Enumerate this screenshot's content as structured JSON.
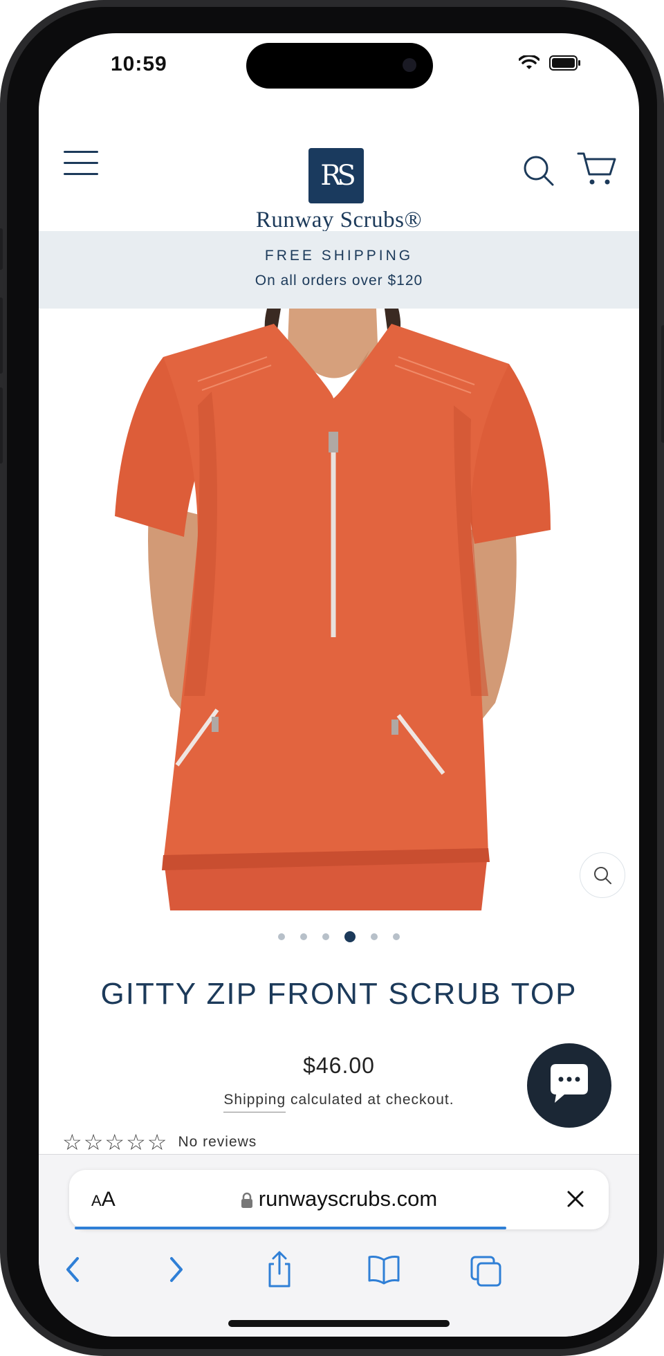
{
  "status_bar": {
    "time": "10:59"
  },
  "header": {
    "logo_monogram": "RS",
    "logo_text": "Runway Scrubs®"
  },
  "banner": {
    "title": "FREE SHIPPING",
    "subtitle": "On all orders over $120"
  },
  "gallery": {
    "dot_count": 6,
    "active_index": 3
  },
  "product": {
    "title": "GITTY ZIP FRONT SCRUB TOP",
    "price": "$46.00",
    "shipping_link": "Shipping",
    "shipping_rest": " calculated at checkout.",
    "stars": "☆☆☆☆☆",
    "rating": 0,
    "reviews_label": "No reviews"
  },
  "browser": {
    "text_size_label": "AA",
    "url": "runwayscrubs.com",
    "load_progress": 0.8
  },
  "colors": {
    "brand_navy": "#1c3a5a",
    "banner_bg": "#e8edf1",
    "scrub_orange": "#e2643f",
    "link_blue": "#2f7fd6"
  }
}
